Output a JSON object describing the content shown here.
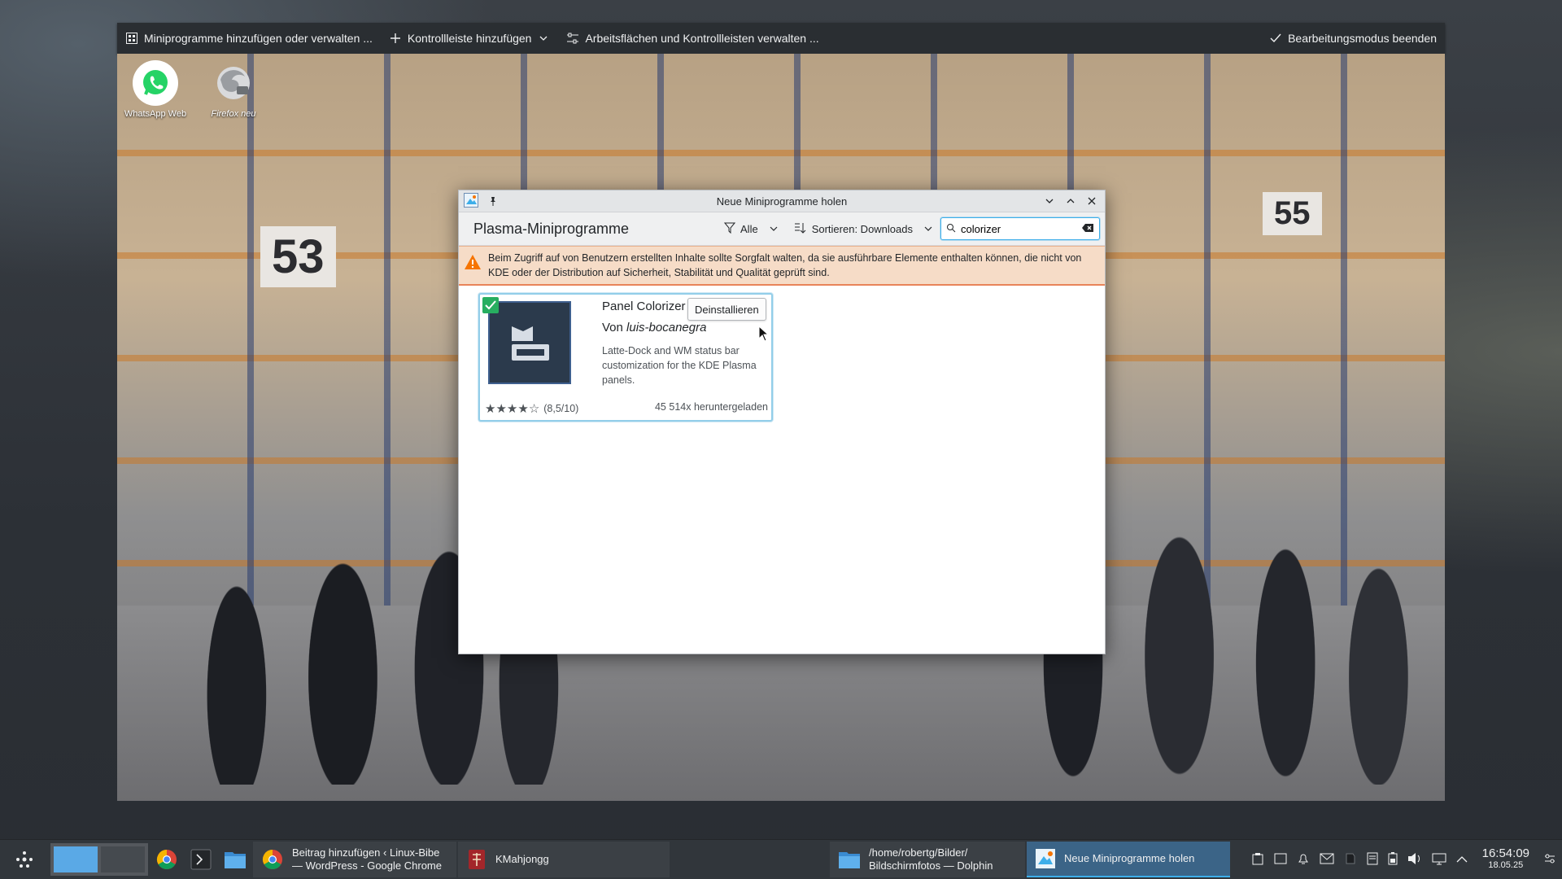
{
  "edit_toolbar": {
    "add_widgets": "Miniprogramme hinzufügen oder verwalten ...",
    "add_panel": "Kontrollleiste hinzufügen",
    "manage_desktops": "Arbeitsflächen und Kontrollleisten verwalten ...",
    "exit_edit": "Bearbeitungsmodus beenden"
  },
  "desktop": {
    "icons": [
      {
        "label": "WhatsApp Web",
        "icon": "whatsapp-icon"
      },
      {
        "label": "Firefox neu",
        "icon": "firefox-icon"
      }
    ],
    "wallpaper_numbers": [
      "53",
      "55"
    ]
  },
  "dialog": {
    "title": "Neue Miniprogramme holen",
    "heading": "Plasma-Miniprogramme",
    "filter_label": "Alle",
    "sort_label": "Sortieren: Downloads",
    "search_value": "colorizer",
    "warning_text": "Beim Zugriff auf von Benutzern erstellten Inhalte sollte Sorgfalt walten, da sie ausführbare Elemente enthalten können, die nicht von KDE oder der Distribution auf Sicherheit, Stabilität und Qualität geprüft sind.",
    "item": {
      "title": "Panel Colorizer",
      "author_prefix": "Von",
      "author": "luis-bocanegra",
      "description": "Latte-Dock and WM status bar customization for the KDE Plasma panels.",
      "rating": 4,
      "rating_text": "(8,5/10)",
      "downloads": "45 514x heruntergeladen",
      "uninstall_label": "Deinstallieren",
      "installed": true
    }
  },
  "taskbar": {
    "tasks": [
      {
        "line1": "Beitrag hinzufügen ‹ Linux-Bibe",
        "line2": "— WordPress - Google Chrome",
        "icon": "chrome-icon"
      },
      {
        "line1": "KMahjongg",
        "line2": "",
        "icon": "kmahjongg-icon"
      },
      {
        "line1": "/home/robertg/Bilder/",
        "line2": "Bildschirmfotos — Dolphin",
        "icon": "dolphin-icon"
      },
      {
        "line1": "Neue Miniprogramme holen",
        "line2": "",
        "icon": "plasma-widgets-icon",
        "active": true
      }
    ],
    "clock": {
      "time": "16:54:09",
      "date": "18.05.25"
    }
  },
  "colors": {
    "accent": "#3daee9",
    "warning_bg": "#f6dcc7",
    "installed_badge": "#27ae60"
  }
}
